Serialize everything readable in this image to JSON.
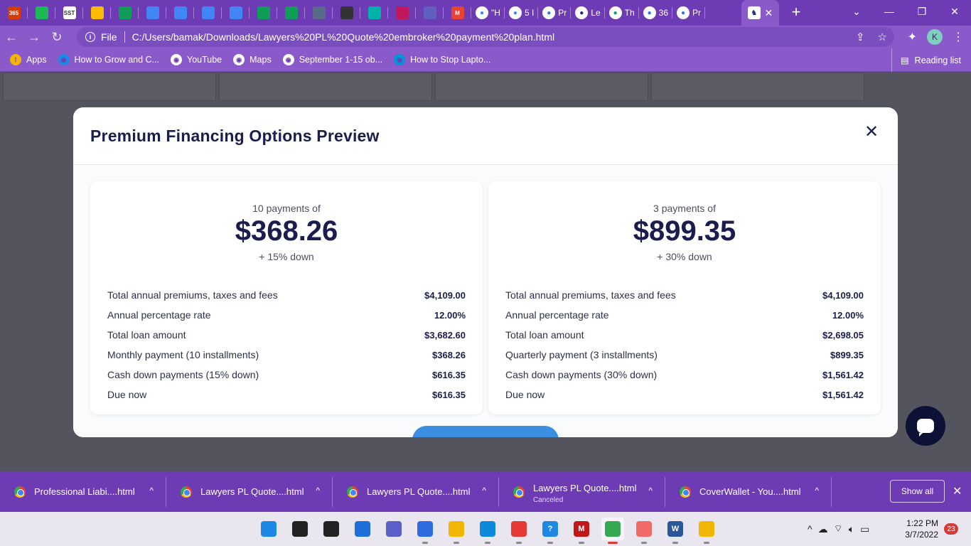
{
  "browser": {
    "pinned_tabs": [
      {
        "icon": "office365-icon",
        "text": "365",
        "color": "#d83b01"
      },
      {
        "icon": "spotify-icon",
        "text": "",
        "color": "#1db954"
      },
      {
        "icon": "sst-icon",
        "text": "SST",
        "color": "#ffffff"
      },
      {
        "icon": "drive-icon",
        "text": "",
        "color": "#fbbc04"
      },
      {
        "icon": "sheets-icon",
        "text": "",
        "color": "#0f9d58"
      },
      {
        "icon": "docs-icon",
        "text": "",
        "color": "#4285f4"
      },
      {
        "icon": "docs-icon",
        "text": "",
        "color": "#4285f4"
      },
      {
        "icon": "docs-icon",
        "text": "",
        "color": "#4285f4"
      },
      {
        "icon": "docs-icon",
        "text": "",
        "color": "#4285f4"
      },
      {
        "icon": "sheets-icon",
        "text": "",
        "color": "#0f9d58"
      },
      {
        "icon": "sheets-icon",
        "text": "",
        "color": "#0f9d58"
      },
      {
        "icon": "person-icon",
        "text": "",
        "color": "#5a6a8a"
      },
      {
        "icon": "globe-icon",
        "text": "",
        "color": "#333333"
      },
      {
        "icon": "home-icon",
        "text": "",
        "color": "#00b2a9"
      },
      {
        "icon": "circle-icon",
        "text": "",
        "color": "#c2185b"
      },
      {
        "icon": "bars-icon",
        "text": "",
        "color": "#6060c0"
      },
      {
        "icon": "gmail-icon",
        "text": "M",
        "color": "#ea4335"
      }
    ],
    "labeled_tabs": [
      {
        "icon": "google-icon",
        "label": "\"H",
        "color": "#4285f4"
      },
      {
        "icon": "google-icon",
        "label": "5 I",
        "color": "#4285f4"
      },
      {
        "icon": "edge-icon",
        "label": "Pr",
        "color": "#2a7ae2"
      },
      {
        "icon": "horse-icon",
        "label": "Le",
        "color": "#1a237e"
      },
      {
        "icon": "trend-icon",
        "label": "Th",
        "color": "#00a86b"
      },
      {
        "icon": "shield-icon",
        "label": "36",
        "color": "#3a6ee8"
      },
      {
        "icon": "edge-icon",
        "label": "Pr",
        "color": "#2a7ae2"
      }
    ],
    "active_tab": {
      "icon": "horse-icon"
    },
    "address": {
      "scheme_label": "File",
      "url": "C:/Users/bamak/Downloads/Lawyers%20PL%20Quote%20embroker%20payment%20plan.html"
    },
    "profile_initial": "K",
    "bookmarks": [
      {
        "icon": "apps-grid-icon",
        "label": "Apps",
        "color": "#f4b400"
      },
      {
        "icon": "bookmark-site-icon",
        "label": "How to Grow and C...",
        "color": "#1e88e5"
      },
      {
        "icon": "globe-icon",
        "label": "YouTube",
        "color": "#ffffff"
      },
      {
        "icon": "globe-icon",
        "label": "Maps",
        "color": "#ffffff"
      },
      {
        "icon": "globe-icon",
        "label": "September 1-15 ob...",
        "color": "#ffffff"
      },
      {
        "icon": "hp-icon",
        "label": "How to Stop Lapto...",
        "color": "#0096d6"
      }
    ],
    "reading_list": "Reading list"
  },
  "modal": {
    "title": "Premium Financing Options Preview",
    "options": [
      {
        "subtitle": "10 payments of",
        "amount": "$368.26",
        "down": "+ 15% down",
        "rows": [
          {
            "label": "Total annual premiums, taxes and fees",
            "value": "$4,109.00"
          },
          {
            "label": "Annual percentage rate",
            "value": "12.00%"
          },
          {
            "label": "Total loan amount",
            "value": "$3,682.60"
          },
          {
            "label": "Monthly payment (10 installments)",
            "value": "$368.26"
          },
          {
            "label": "Cash down payments (15% down)",
            "value": "$616.35"
          },
          {
            "label": "Due now",
            "value": "$616.35"
          }
        ]
      },
      {
        "subtitle": "3 payments of",
        "amount": "$899.35",
        "down": "+ 30% down",
        "rows": [
          {
            "label": "Total annual premiums, taxes and fees",
            "value": "$4,109.00"
          },
          {
            "label": "Annual percentage rate",
            "value": "12.00%"
          },
          {
            "label": "Total loan amount",
            "value": "$2,698.05"
          },
          {
            "label": "Quarterly payment (3 installments)",
            "value": "$899.35"
          },
          {
            "label": "Cash down payments (30% down)",
            "value": "$1,561.42"
          },
          {
            "label": "Due now",
            "value": "$1,561.42"
          }
        ]
      }
    ]
  },
  "downloads": {
    "items": [
      {
        "name": "Professional Liabi....html",
        "status": ""
      },
      {
        "name": "Lawyers PL Quote....html",
        "status": ""
      },
      {
        "name": "Lawyers PL Quote....html",
        "status": ""
      },
      {
        "name": "Lawyers PL Quote....html",
        "status": "Canceled"
      },
      {
        "name": "CoverWallet - You....html",
        "status": ""
      }
    ],
    "show_all": "Show all"
  },
  "taskbar": {
    "apps": [
      {
        "icon": "windows-start-icon",
        "color": "#1e88e5",
        "text": ""
      },
      {
        "icon": "search-icon",
        "color": "#222222",
        "text": ""
      },
      {
        "icon": "task-view-icon",
        "color": "#222222",
        "text": ""
      },
      {
        "icon": "widgets-icon",
        "color": "#1e6fd9",
        "text": ""
      },
      {
        "icon": "chat-icon",
        "color": "#5b5fc7",
        "text": ""
      },
      {
        "icon": "store-icon",
        "color": "#2d6cdf",
        "text": ""
      },
      {
        "icon": "file-explorer-icon",
        "color": "#f2b705",
        "text": ""
      },
      {
        "icon": "edge-icon",
        "color": "#0c8ad9",
        "text": ""
      },
      {
        "icon": "cast-icon",
        "color": "#e53935",
        "text": ""
      },
      {
        "icon": "help-icon",
        "color": "#1e88e5",
        "text": "?"
      },
      {
        "icon": "mcafee-icon",
        "color": "#c01818",
        "text": "M"
      },
      {
        "icon": "chrome-icon",
        "color": "#34a853",
        "text": ""
      },
      {
        "icon": "asana-icon",
        "color": "#f06a6a",
        "text": ""
      },
      {
        "icon": "word-icon",
        "color": "#2b579a",
        "text": "W"
      },
      {
        "icon": "onedrive-icon",
        "color": "#f2b705",
        "text": ""
      }
    ],
    "active_index": 11,
    "time": "1:22 PM",
    "date": "3/7/2022",
    "notification_count": "23"
  }
}
